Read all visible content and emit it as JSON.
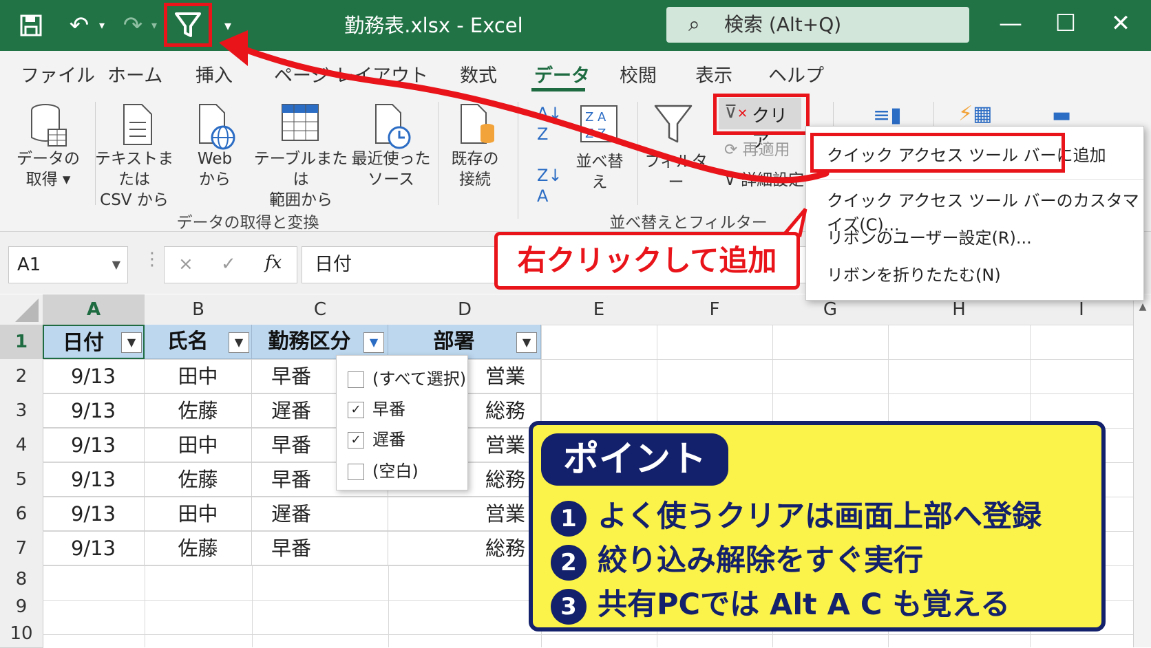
{
  "titlebar": {
    "title": "勤務表.xlsx  -  Excel",
    "search_placeholder": "検索 (Alt+Q)",
    "icons": [
      "save-icon",
      "undo-icon",
      "redo-icon",
      "filter-icon",
      "customize-qat-icon",
      "minimize-icon",
      "maximize-icon",
      "close-icon"
    ]
  },
  "tabs": [
    "ファイル",
    "ホーム",
    "挿入",
    "ページ レイアウト",
    "数式",
    "データ",
    "校閲",
    "表示",
    "ヘルプ"
  ],
  "active_tab": "データ",
  "ribbon": {
    "get_data": {
      "line1": "データの",
      "line2": "取得 ▾"
    },
    "text_csv": {
      "line1": "テキストまたは",
      "line2": "CSV から"
    },
    "web": {
      "line1": "Web",
      "line2": "から"
    },
    "table_range": {
      "line1": "テーブルまたは",
      "line2": "範囲から"
    },
    "recent_sources": {
      "line1": "最近使った",
      "line2": "ソース"
    },
    "existing_conn": {
      "line1": "既存の",
      "line2": "接続"
    },
    "group1": "データの取得と変換",
    "sort": "並べ替え",
    "filter": "フィルター",
    "clear": "クリア",
    "reapply": "再適用",
    "advanced": "詳細設定",
    "group2": "並べ替えとフィルター"
  },
  "context_menu": {
    "items": [
      "クイック アクセス ツール バーに追加",
      "クイック アクセス ツール バーのカスタマイズ(C)...",
      "リボンのユーザー設定(R)...",
      "リボンを折りたたむ(N)"
    ]
  },
  "callout": "右クリックして追加",
  "formula_bar": {
    "name_box": "A1",
    "formula": "日付",
    "cancel": "×",
    "enter": "✓",
    "fx": "fx"
  },
  "columns": [
    "A",
    "B",
    "C",
    "D",
    "E",
    "F",
    "G",
    "H",
    "I"
  ],
  "rows": [
    "1",
    "2",
    "3",
    "4",
    "5",
    "6",
    "7",
    "8",
    "9",
    "10"
  ],
  "table": {
    "headers": [
      "日付",
      "氏名",
      "勤務区分",
      "部署"
    ],
    "rows": [
      [
        "9/13",
        "田中",
        "早番",
        "営業"
      ],
      [
        "9/13",
        "佐藤",
        "遅番",
        "総務"
      ],
      [
        "9/13",
        "田中",
        "早番",
        "営業"
      ],
      [
        "9/13",
        "佐藤",
        "早番",
        "総務"
      ],
      [
        "9/13",
        "田中",
        "遅番",
        "営業"
      ],
      [
        "9/13",
        "佐藤",
        "早番",
        "総務"
      ]
    ]
  },
  "filter_popup": {
    "items": [
      {
        "label": "(すべて選択)",
        "checked": false
      },
      {
        "label": "早番",
        "checked": true
      },
      {
        "label": "遅番",
        "checked": true
      },
      {
        "label": "(空白)",
        "checked": false
      }
    ]
  },
  "point": {
    "tag": "ポイント",
    "lines": [
      {
        "num": "1",
        "text": "よく使うクリアは画面上部へ登録"
      },
      {
        "num": "2",
        "text": "絞り込み解除をすぐ実行"
      },
      {
        "num": "3",
        "text": "共有PCでは Alt A C も覚える"
      }
    ]
  },
  "colors": {
    "excel_green": "#217346",
    "highlight_red": "#e8141a",
    "point_yellow": "#fbf24a",
    "point_navy": "#13206b",
    "header_blue": "#bdd7ee"
  }
}
